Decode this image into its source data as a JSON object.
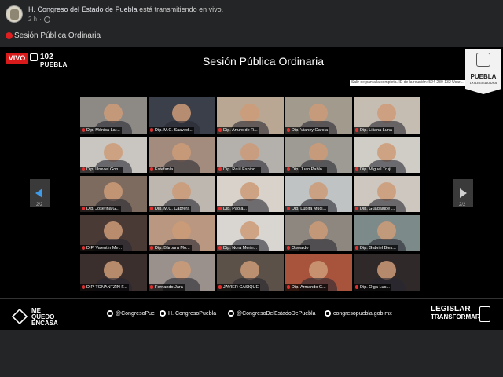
{
  "facebook": {
    "page_name": "H. Congreso del Estado de Puebla",
    "status_text": "está transmitiendo en vivo.",
    "time_ago": "2 h",
    "post_title": "Sesión Pública Ordinaria",
    "globe_icon": "globe-icon",
    "live_dot_color": "#e02020"
  },
  "video": {
    "live_badge": "VIVO",
    "logo_number": "102",
    "logo_name": "PUEBLA",
    "logo_sub": "LXI LEGISLATURA",
    "session_title": "Sesión Pública Ordinaria",
    "emblem_name": "PUEBLA",
    "emblem_sub": "LXI LEGISLATURA",
    "exit_notice": "Salir de pantalla completa. ID de la reunión: 524-280-132 Usar...",
    "page_left": "2/2",
    "page_right": "2/2",
    "participants": [
      "Dip. Mónica Lar...",
      "Dip. M.C. Saaved...",
      "Dip. Arturo de R...",
      "Dip. Vianey García",
      "Dip. Liliana Luna",
      "Dip. Uruviel Gon...",
      "Estefanía",
      "Dip. Raúl Espino...",
      "Dip. Juan Pablo...",
      "Dip. Miguel Trují...",
      "Dip. Josefina G...",
      "Dip. M.C. Cabrera",
      "Dip. Paola...",
      "Dip. Lupita Muci...",
      "Dip. Guadalupe ...",
      "DIP. Valentín Me...",
      "Dip. Bárbara Mo...",
      "Dip. Nora Merin...",
      "Oswaldo",
      "Dip. Gabriel Bies...",
      "DIP. TONANTZIN F...",
      "Fernando Jara",
      "JAVIER CASIQUE",
      "Dip. Armando G...",
      "Dip. Olga Luc..."
    ]
  },
  "footer": {
    "campaign_line1": "ME",
    "campaign_line2": "QUEDO",
    "campaign_line3": "ENCASA",
    "twitter": "@CongresoPue",
    "facebook": "H. CongresoPuebla",
    "instagram": "@CongresoDelEstadoDePuebla",
    "website": "congresopuebla.gob.mx",
    "slogan_line1": "LEGISLAR",
    "slogan_line2": "TRANSFORMAR",
    "slogan_para": "PARA"
  }
}
